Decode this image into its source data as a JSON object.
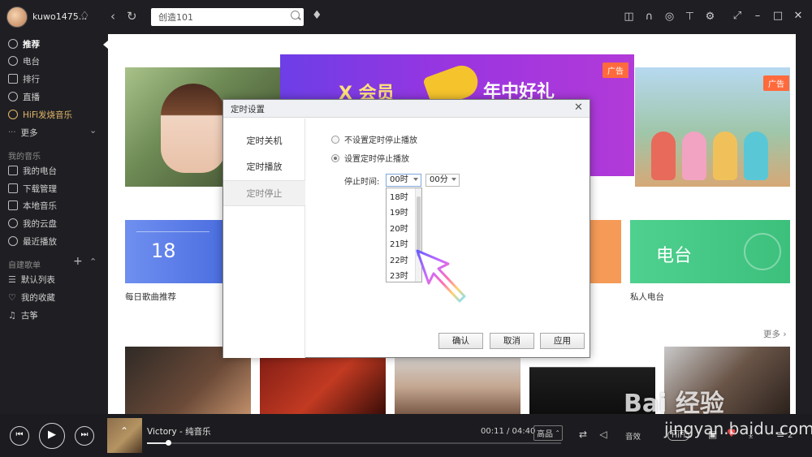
{
  "header": {
    "username": "kuwo1475...",
    "search_value": "创造101",
    "search_placeholder": ""
  },
  "sidebar": {
    "items": [
      {
        "label": "推荐",
        "icon": "disc-icon"
      },
      {
        "label": "电台",
        "icon": "radio-icon"
      },
      {
        "label": "排行",
        "icon": "chart-icon"
      },
      {
        "label": "直播",
        "icon": "mic-icon"
      },
      {
        "label": "HiFi发烧音乐",
        "icon": "hifi-icon"
      },
      {
        "label": "更多",
        "icon": "more-icon"
      }
    ],
    "my_music_title": "我的音乐",
    "my_music": [
      {
        "label": "我的电台"
      },
      {
        "label": "下载管理"
      },
      {
        "label": "本地音乐"
      },
      {
        "label": "我的云盘"
      },
      {
        "label": "最近播放"
      }
    ],
    "playlists_title": "自建歌单",
    "playlists": [
      {
        "label": "默认列表"
      },
      {
        "label": "我的收藏"
      },
      {
        "label": "古筝"
      }
    ]
  },
  "main": {
    "ad_label_center": "广告",
    "ad_label_right": "广告",
    "banner_text_1": "X 会员",
    "banner_text_2": "年中好礼",
    "card_daily_num": "18",
    "card_daily_caption": "每日歌曲推荐",
    "card_radio_label": "电台",
    "card_radio_caption": "私人电台",
    "more_link": "更多 ›"
  },
  "dialog": {
    "title": "定时设置",
    "tabs": [
      "定时关机",
      "定时播放",
      "定时停止"
    ],
    "radio_no_stop": "不设置定时停止播放",
    "radio_set_stop": "设置定时停止播放",
    "stop_time_label": "停止时间:",
    "hour_value": "00时",
    "minute_value": "00分",
    "hour_options": [
      "18时",
      "19时",
      "20时",
      "21时",
      "22时",
      "23时"
    ],
    "confirm_label": "确认",
    "cancel_label": "取消",
    "apply_label": "应用"
  },
  "player": {
    "song_title": "Victory - 纯音乐",
    "time": "00:11 / 04:40",
    "quality": "高品 ˆ",
    "sound_label": "音效",
    "hifi_label": "HiFi",
    "playlist_count": "2",
    "progress": 0.05
  },
  "watermark": {
    "logo": "Bai 经验",
    "url": "jingyan.baidu.com"
  },
  "colors": {
    "dark_bg": "#1f1f23",
    "accent_gold": "#e4b86a",
    "card_blue": "#5a7ce8",
    "card_green": "#45c985",
    "ad_tag": "#ff6a3d"
  }
}
